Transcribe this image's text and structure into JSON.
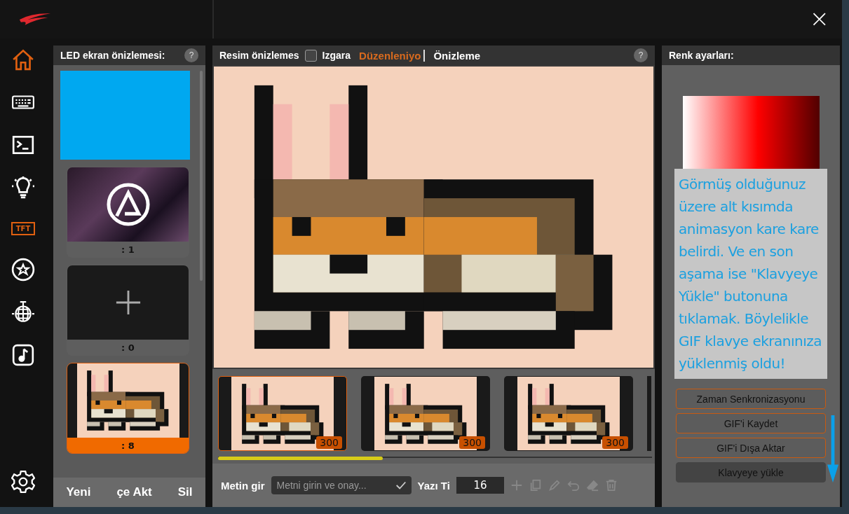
{
  "window": {
    "close": "×"
  },
  "nav": [
    {
      "kind": "home",
      "selected": true
    },
    {
      "kind": "keyboard",
      "selected": false
    },
    {
      "kind": "terminal",
      "selected": false
    },
    {
      "kind": "bulb",
      "selected": false
    },
    {
      "kind": "tft",
      "label": "TFT",
      "selected": true
    },
    {
      "kind": "star",
      "selected": false
    },
    {
      "kind": "disco",
      "selected": false
    },
    {
      "kind": "music",
      "selected": false
    }
  ],
  "nav_bottom": {
    "kind": "settings"
  },
  "led_panel": {
    "title": "LED ekran önizlemesi:",
    "help": "?",
    "items": [
      {
        "kind": "color",
        "color": "#00a8f0"
      },
      {
        "kind": "image",
        "caption": ": 1",
        "selected": false
      },
      {
        "kind": "add",
        "caption": ": 0",
        "selected": false
      },
      {
        "kind": "cat",
        "caption": ": 8",
        "selected": true
      }
    ],
    "buttons": [
      "Yeni",
      "çe Akt",
      "Sil"
    ]
  },
  "editor": {
    "title": "Resim önizlemes",
    "grid_checkbox": {
      "label": "Izgara",
      "checked": false
    },
    "modes": [
      {
        "label": "Düzenleniyo",
        "selected": true
      },
      {
        "label": "Önizleme",
        "selected": false
      }
    ],
    "help": "?",
    "frames": [
      {
        "duration": "300",
        "selected": true
      },
      {
        "duration": "300",
        "selected": false
      },
      {
        "duration": "300",
        "selected": false
      }
    ],
    "progress": {
      "level": 0.38
    },
    "text_label": "Metin gir",
    "text_input": {
      "placeholder": "Metni girin ve onay..."
    },
    "font_label": "Yazı Ti",
    "font_size": "16"
  },
  "color_panel": {
    "title": "Renk ayarları:",
    "tooltip": "Görmüş olduğunuz üzere alt kısımda animasyon kare kare belirdi. Ve en son aşama ise \"Klavyeye Yükle\" butonuna tıklamak. Böylelikle GIF klavye ekranınıza yüklenmiş oldu!",
    "buttons": [
      {
        "label": "Zaman Senkronizasyonu",
        "kind": "outline"
      },
      {
        "label": "GIF'i Kaydet",
        "kind": "outline"
      },
      {
        "label": "GIF'i Dışa Aktar",
        "kind": "outline"
      },
      {
        "label": "Klavyeye yükle",
        "kind": "filled"
      }
    ]
  }
}
